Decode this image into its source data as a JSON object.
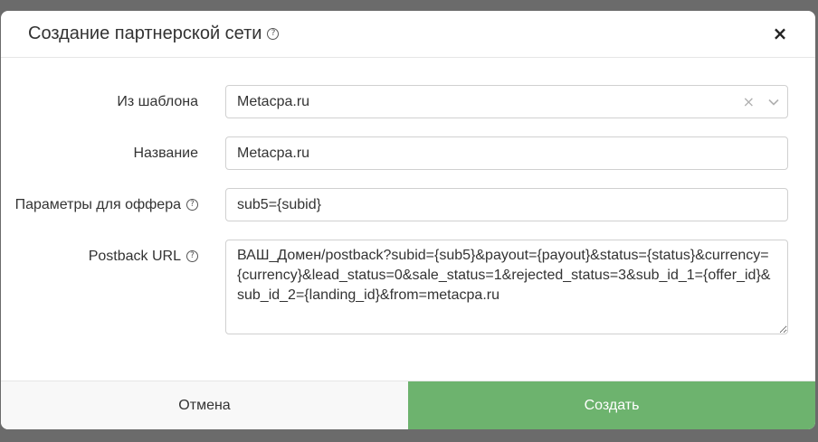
{
  "header": {
    "title": "Создание партнерской сети",
    "help_icon": "?",
    "close_icon": "×"
  },
  "form": {
    "template": {
      "label": "Из шаблона",
      "value": "Metacpa.ru",
      "clear_icon": "×"
    },
    "name": {
      "label": "Название",
      "value": "Metacpa.ru"
    },
    "offer_params": {
      "label": "Параметры для оффера",
      "value": "sub5={subid}"
    },
    "postback": {
      "label": "Postback URL",
      "value": "ВАШ_Домен/postback?subid={sub5}&payout={payout}&status={status}&currency={currency}&lead_status=0&sale_status=1&rejected_status=3&sub_id_1={offer_id}&sub_id_2={landing_id}&from=metacpa.ru"
    }
  },
  "footer": {
    "cancel_label": "Отмена",
    "create_label": "Создать"
  },
  "colors": {
    "create_button": "#6db36e",
    "overlay": "#6b6b6b"
  }
}
